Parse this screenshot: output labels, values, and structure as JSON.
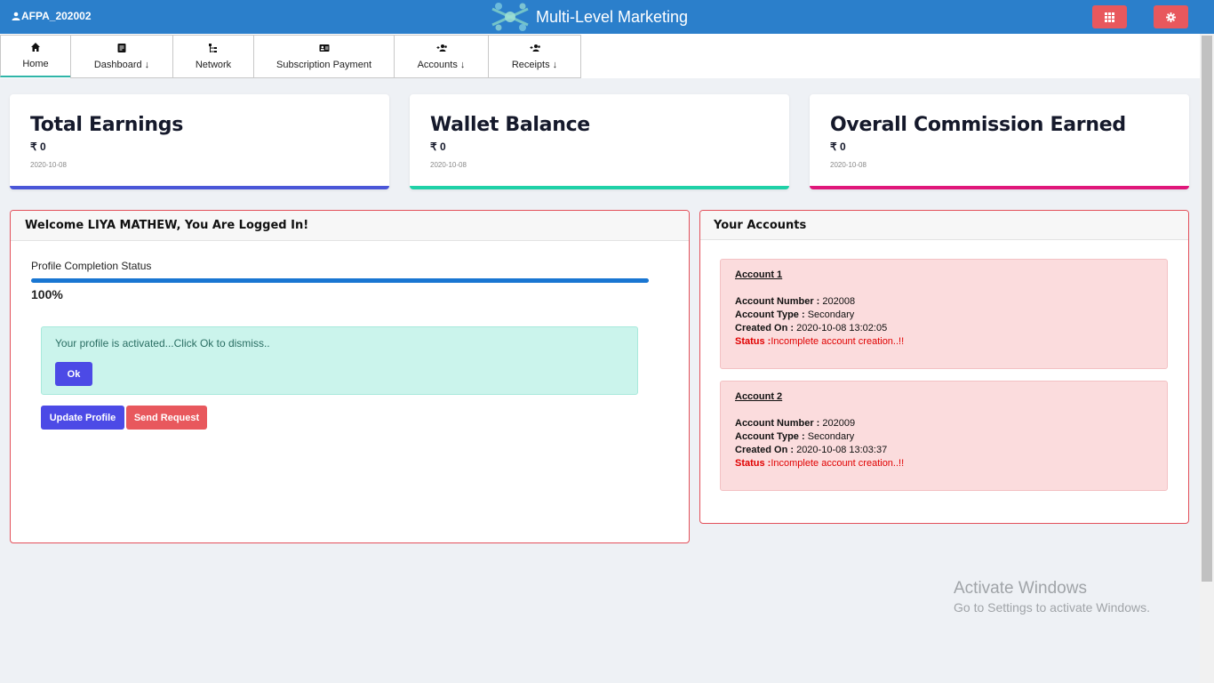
{
  "header": {
    "user_label": "AFPA_202002",
    "title": "Multi-Level Marketing",
    "accent_color": "#2b7fcb"
  },
  "nav": {
    "items": [
      {
        "label": "Home",
        "icon": "home-icon"
      },
      {
        "label": "Dashboard ↓",
        "icon": "dashboard-icon"
      },
      {
        "label": "Network",
        "icon": "network-icon"
      },
      {
        "label": "Subscription Payment",
        "icon": "id-card-icon"
      },
      {
        "label": "Accounts ↓",
        "icon": "user-plus-icon"
      },
      {
        "label": "Receipts ↓",
        "icon": "user-plus-icon"
      }
    ]
  },
  "cards": [
    {
      "title": "Total Earnings",
      "value": "₹ 0",
      "date": "2020-10-08",
      "color": "#4a56d8"
    },
    {
      "title": "Wallet Balance",
      "value": "₹ 0",
      "date": "2020-10-08",
      "color": "#1fd1a7"
    },
    {
      "title": "Overall Commission Earned",
      "value": "₹ 0",
      "date": "2020-10-08",
      "color": "#e0177a"
    }
  ],
  "welcome": {
    "heading": "Welcome LIYA MATHEW, You Are Logged In!",
    "progress_label": "Profile Completion Status",
    "progress_value": "100%",
    "progress_fraction": 1.0,
    "alert_text": "Your profile is activated...Click Ok to dismiss..",
    "ok_label": "Ok",
    "update_label": "Update Profile",
    "send_label": "Send Request"
  },
  "accounts": {
    "heading": "Your Accounts",
    "list": [
      {
        "title": "Account 1",
        "number_label": "Account Number :",
        "number": " 202008",
        "type_label": "Account Type :",
        "type": " Secondary",
        "created_label": "Created On :",
        "created": " 2020-10-08 13:02:05",
        "status_label": "Status :",
        "status": "Incomplete account creation..!!"
      },
      {
        "title": "Account 2",
        "number_label": "Account Number :",
        "number": " 202009",
        "type_label": "Account Type :",
        "type": " Secondary",
        "created_label": "Created On :",
        "created": " 2020-10-08 13:03:37",
        "status_label": "Status :",
        "status": "Incomplete account creation..!!"
      }
    ]
  },
  "watermark": {
    "line1": "Activate Windows",
    "line2": "Go to Settings to activate Windows."
  }
}
